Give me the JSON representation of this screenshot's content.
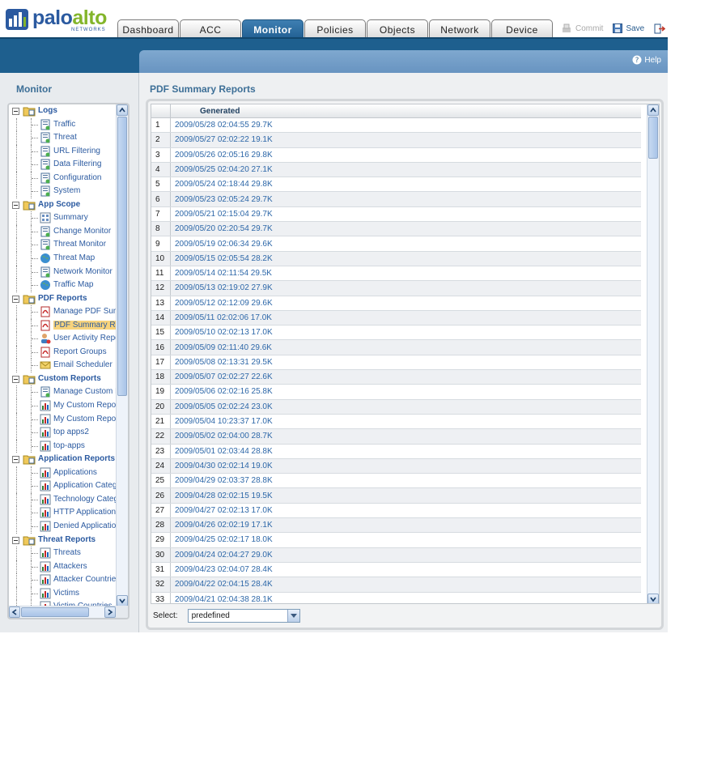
{
  "brand": {
    "name_main": "palo",
    "name_accent": "alto",
    "sub": "NETWORKS"
  },
  "tabs": [
    {
      "label": "Dashboard",
      "active": false
    },
    {
      "label": "ACC",
      "active": false
    },
    {
      "label": "Monitor",
      "active": true
    },
    {
      "label": "Policies",
      "active": false
    },
    {
      "label": "Objects",
      "active": false
    },
    {
      "label": "Network",
      "active": false
    },
    {
      "label": "Device",
      "active": false
    }
  ],
  "toolbar": {
    "commit_label": "Commit",
    "save_label": "Save",
    "help_label": "Help"
  },
  "left": {
    "title": "Monitor",
    "groups": [
      {
        "label": "Logs",
        "icon": "logs-icon",
        "items": [
          {
            "label": "Traffic",
            "icon": "log-traffic-icon"
          },
          {
            "label": "Threat",
            "icon": "log-threat-icon"
          },
          {
            "label": "URL Filtering",
            "icon": "log-url-icon"
          },
          {
            "label": "Data Filtering",
            "icon": "log-data-icon"
          },
          {
            "label": "Configuration",
            "icon": "log-config-icon"
          },
          {
            "label": "System",
            "icon": "log-system-icon"
          }
        ]
      },
      {
        "label": "App Scope",
        "icon": "appscope-icon",
        "items": [
          {
            "label": "Summary",
            "icon": "summary-icon"
          },
          {
            "label": "Change Monitor",
            "icon": "change-monitor-icon"
          },
          {
            "label": "Threat Monitor",
            "icon": "threat-monitor-icon"
          },
          {
            "label": "Threat Map",
            "icon": "globe-icon"
          },
          {
            "label": "Network Monitor",
            "icon": "network-monitor-icon"
          },
          {
            "label": "Traffic Map",
            "icon": "globe-icon"
          }
        ]
      },
      {
        "label": "PDF Reports",
        "icon": "pdf-reports-icon",
        "items": [
          {
            "label": "Manage PDF Summ",
            "icon": "pdf-icon"
          },
          {
            "label": "PDF Summary Rep",
            "icon": "pdf-icon",
            "selected": true
          },
          {
            "label": "User Activity Repo",
            "icon": "user-activity-icon"
          },
          {
            "label": "Report Groups",
            "icon": "pdf-icon"
          },
          {
            "label": "Email Scheduler",
            "icon": "email-icon"
          }
        ]
      },
      {
        "label": "Custom Reports",
        "icon": "custom-reports-icon",
        "items": [
          {
            "label": "Manage Custom R",
            "icon": "manage-report-icon"
          },
          {
            "label": "My Custom Report",
            "icon": "bar-chart-icon"
          },
          {
            "label": "My Custom Report",
            "icon": "bar-chart-icon"
          },
          {
            "label": "top apps2",
            "icon": "bar-chart-icon"
          },
          {
            "label": "top-apps",
            "icon": "bar-chart-icon"
          }
        ]
      },
      {
        "label": "Application Reports",
        "icon": "app-reports-icon",
        "items": [
          {
            "label": "Applications",
            "icon": "bar-chart-icon"
          },
          {
            "label": "Application Categ",
            "icon": "bar-chart-icon"
          },
          {
            "label": "Technology Categ",
            "icon": "bar-chart-icon"
          },
          {
            "label": "HTTP Applications",
            "icon": "bar-chart-icon"
          },
          {
            "label": "Denied Application",
            "icon": "bar-chart-icon"
          }
        ]
      },
      {
        "label": "Threat Reports",
        "icon": "threat-reports-icon",
        "items": [
          {
            "label": "Threats",
            "icon": "bar-chart-icon"
          },
          {
            "label": "Attackers",
            "icon": "bar-chart-icon"
          },
          {
            "label": "Attacker Countries",
            "icon": "bar-chart-icon"
          },
          {
            "label": "Victims",
            "icon": "bar-chart-icon"
          },
          {
            "label": "Victim Countries",
            "icon": "bar-chart-icon"
          }
        ]
      }
    ]
  },
  "main": {
    "title": "PDF Summary Reports",
    "column_header": "Generated",
    "rows": [
      "2009/05/28 02:04:55 29.7K",
      "2009/05/27 02:02:22 19.1K",
      "2009/05/26 02:05:16 29.8K",
      "2009/05/25 02:04:20 27.1K",
      "2009/05/24 02:18:44 29.8K",
      "2009/05/23 02:05:24 29.7K",
      "2009/05/21 02:15:04 29.7K",
      "2009/05/20 02:20:54 29.7K",
      "2009/05/19 02:06:34 29.6K",
      "2009/05/15 02:05:54 28.2K",
      "2009/05/14 02:11:54 29.5K",
      "2009/05/13 02:19:02 27.9K",
      "2009/05/12 02:12:09 29.6K",
      "2009/05/11 02:02:06 17.0K",
      "2009/05/10 02:02:13 17.0K",
      "2009/05/09 02:11:40 29.6K",
      "2009/05/08 02:13:31 29.5K",
      "2009/05/07 02:02:27 22.6K",
      "2009/05/06 02:02:16 25.8K",
      "2009/05/05 02:02:24 23.0K",
      "2009/05/04 10:23:37 17.0K",
      "2009/05/02 02:04:00 28.7K",
      "2009/05/01 02:03:44 28.8K",
      "2009/04/30 02:02:14 19.0K",
      "2009/04/29 02:03:37 28.8K",
      "2009/04/28 02:02:15 19.5K",
      "2009/04/27 02:02:13 17.0K",
      "2009/04/26 02:02:19 17.1K",
      "2009/04/25 02:02:17 18.0K",
      "2009/04/24 02:04:27 29.0K",
      "2009/04/23 02:04:07 28.4K",
      "2009/04/22 02:04:15 28.4K",
      "2009/04/21 02:04:38 28.1K"
    ],
    "select_label": "Select:",
    "select_value": "predefined"
  },
  "colors": {
    "brand_blue": "#2b5aa0",
    "brand_green": "#83b52b",
    "band": "#1e5f8e",
    "link": "#2d67a8",
    "selected": "#f7d37c"
  }
}
